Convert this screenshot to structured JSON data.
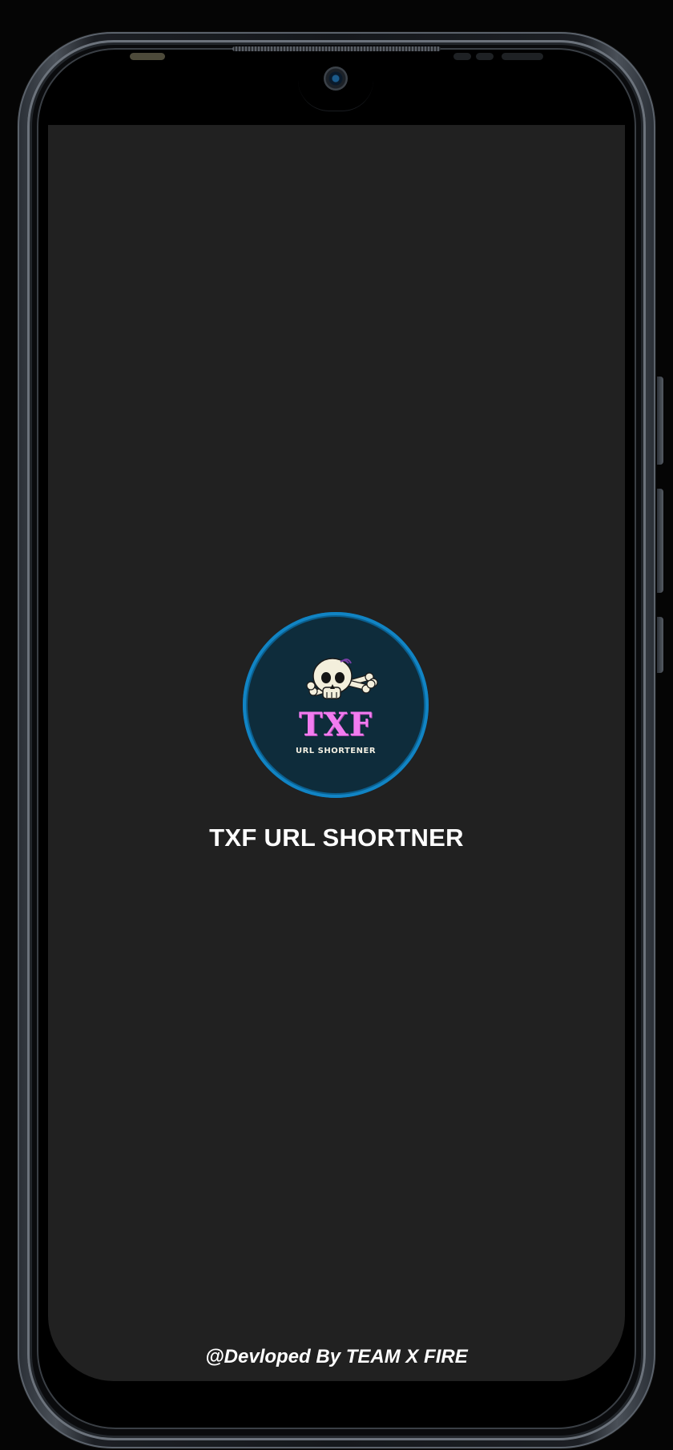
{
  "app": {
    "title": "TXF URL SHORTNER"
  },
  "logo": {
    "wordmark": "TXF",
    "subtitle": "URL SHORTENER",
    "icon": "skull-crossbones-icon",
    "colors": {
      "ring": "#1184c4",
      "background": "#0e2c3b",
      "wordmark": "#f27cf0",
      "skull": "#f3efdc"
    }
  },
  "footer": {
    "credit": "@Devloped By TEAM X FIRE"
  },
  "theme": {
    "screen_background": "#212121",
    "text": "#ffffff"
  }
}
